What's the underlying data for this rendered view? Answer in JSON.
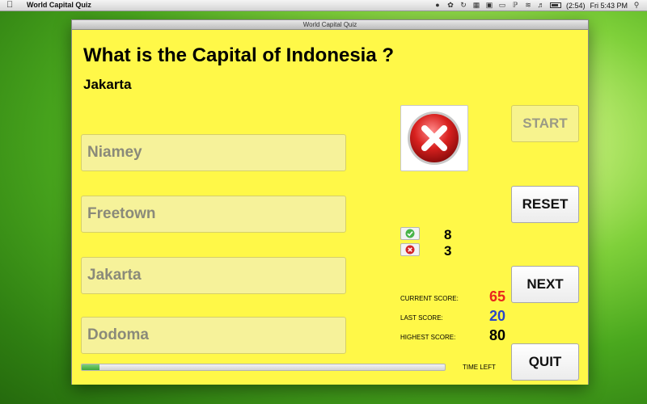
{
  "menubar": {
    "app_name": "World Capital Quiz",
    "battery": "(2:54)",
    "clock": "Fri 5:43 PM"
  },
  "window": {
    "title": "World Capital Quiz"
  },
  "quiz": {
    "question": "What is the Capital of Indonesia ?",
    "correct_answer": "Jakarta",
    "options": [
      "Niamey",
      "Freetown",
      "Jakarta",
      "Dodoma"
    ],
    "result_icon": "wrong-x-icon"
  },
  "buttons": {
    "start": "START",
    "reset": "RESET",
    "next": "NEXT",
    "quit": "QUIT"
  },
  "tally": {
    "correct_icon": "check-icon",
    "wrong_icon": "cross-icon",
    "correct": "8",
    "wrong": "3"
  },
  "scores": {
    "current_label": "CURRENT SCORE:",
    "current_value": "65",
    "last_label": "LAST SCORE:",
    "last_value": "20",
    "highest_label": "HIGHEST SCORE:",
    "highest_value": "80",
    "colors": {
      "current": "#e8261d",
      "last": "#2a46c9",
      "highest": "#000000"
    }
  },
  "timer": {
    "label": "TIME LEFT",
    "progress_fraction": 0.05
  },
  "colors": {
    "window_bg": "#fff848",
    "option_bg": "#f6f29a",
    "option_text": "#8a8a7a"
  }
}
